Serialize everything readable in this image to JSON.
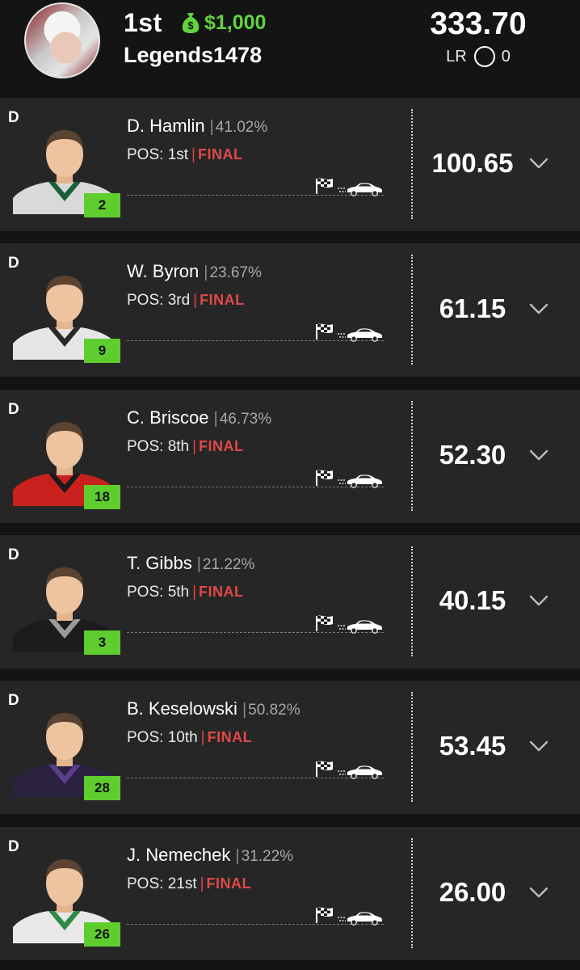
{
  "header": {
    "rank": "1st",
    "prize": "$1,000",
    "username": "Legends1478",
    "total_points": "333.70",
    "lr_label": "LR",
    "lr_value": "0"
  },
  "colors": {
    "accent_green": "#5fcd2e",
    "prize_green": "#62d43c",
    "final_red": "#e04848",
    "card_bg": "#262626",
    "page_bg": "#131313"
  },
  "players": [
    {
      "slot": "D",
      "name": "D. Hamlin",
      "ownership": "41.02%",
      "pos_label": "POS:",
      "finish": "1st",
      "status": "FINAL",
      "car_number": "2",
      "points": "100.65",
      "suit": "#d9d9d9",
      "suit2": "#1b5e3a"
    },
    {
      "slot": "D",
      "name": "W. Byron",
      "ownership": "23.67%",
      "pos_label": "POS:",
      "finish": "3rd",
      "status": "FINAL",
      "car_number": "9",
      "points": "61.15",
      "suit": "#e6e6e6",
      "suit2": "#2a2a2a"
    },
    {
      "slot": "D",
      "name": "C. Briscoe",
      "ownership": "46.73%",
      "pos_label": "POS:",
      "finish": "8th",
      "status": "FINAL",
      "car_number": "18",
      "points": "52.30",
      "suit": "#c8201c",
      "suit2": "#1a1a1a"
    },
    {
      "slot": "D",
      "name": "T. Gibbs",
      "ownership": "21.22%",
      "pos_label": "POS:",
      "finish": "5th",
      "status": "FINAL",
      "car_number": "3",
      "points": "40.15",
      "suit": "#1c1c1c",
      "suit2": "#9b9b9b"
    },
    {
      "slot": "D",
      "name": "B. Keselowski",
      "ownership": "50.82%",
      "pos_label": "POS:",
      "finish": "10th",
      "status": "FINAL",
      "car_number": "28",
      "points": "53.45",
      "suit": "#2a2240",
      "suit2": "#5b3d8c"
    },
    {
      "slot": "D",
      "name": "J. Nemechek",
      "ownership": "31.22%",
      "pos_label": "POS:",
      "finish": "21st",
      "status": "FINAL",
      "car_number": "26",
      "points": "26.00",
      "suit": "#e8e8e8",
      "suit2": "#2e8a45"
    }
  ],
  "icons": {
    "prize": "money-bag-icon",
    "flag": "checkered-flag-icon",
    "car": "race-car-icon",
    "expand": "chevron-down-icon",
    "lr": "ring-icon"
  }
}
